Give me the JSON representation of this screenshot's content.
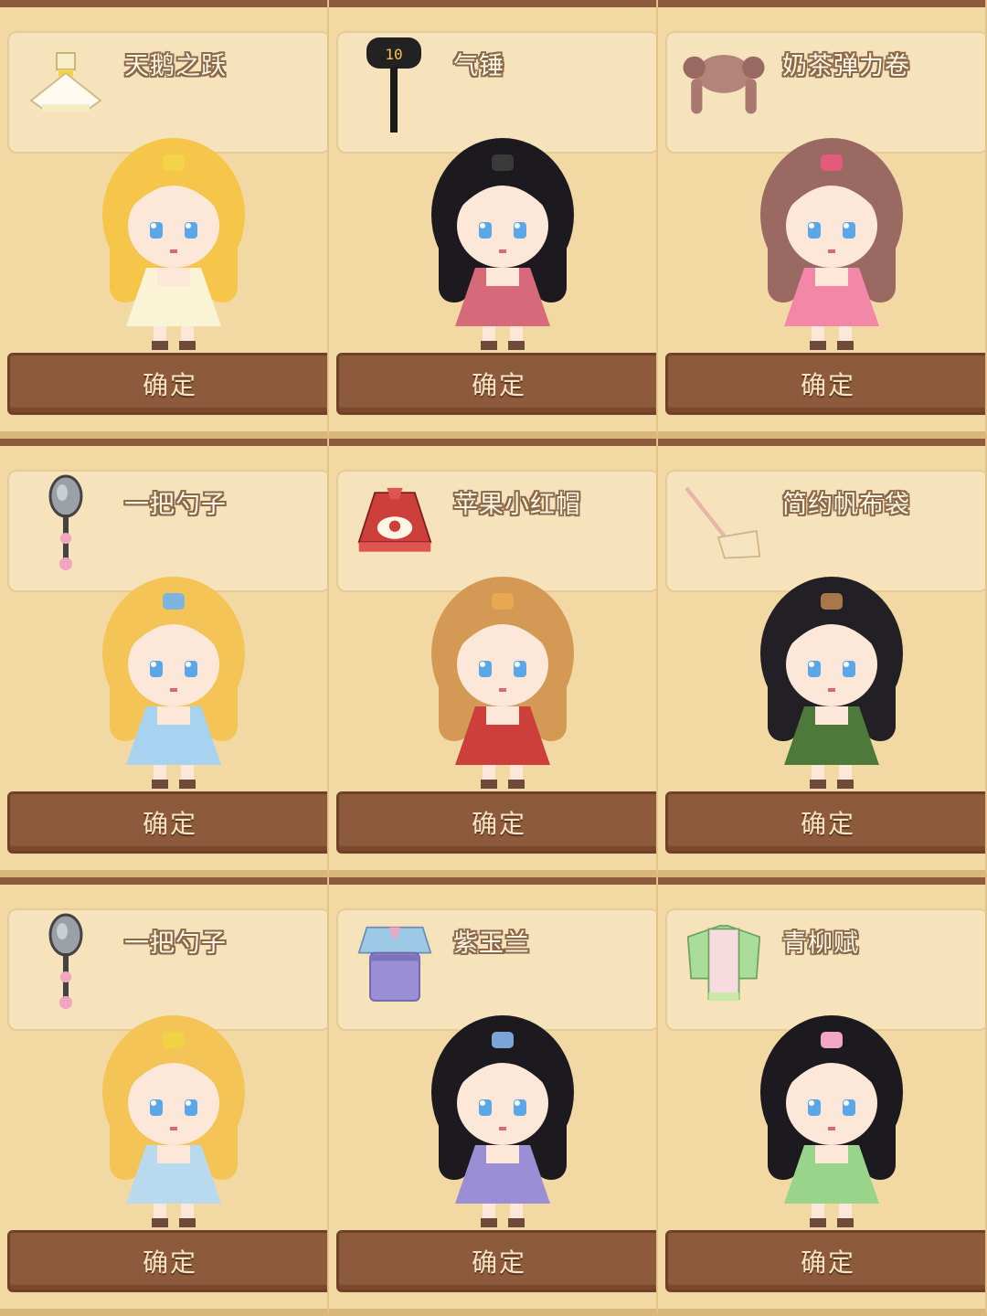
{
  "cards": [
    {
      "name": "天鹅之跃",
      "icon": "ballet-dress-icon",
      "hair": "#f6c64a",
      "outfit": "#fbf3d6",
      "accent": "#f3d34a",
      "button": "确定"
    },
    {
      "name": "气锤",
      "icon": "hammer-icon",
      "hammer_label": "10",
      "hair": "#1d1a1f",
      "outfit": "#d76a7a",
      "accent": "#3a3a3a",
      "button": "确定"
    },
    {
      "name": "奶茶弹力卷",
      "icon": "curly-hair-icon",
      "hair": "#9a6a62",
      "outfit": "#f287a7",
      "accent": "#e35b7b",
      "button": "确定"
    },
    {
      "name": "一把勺子",
      "icon": "spoon-icon",
      "hair": "#f4c457",
      "outfit": "#a8d3f0",
      "accent": "#7cb6e0",
      "button": "确定"
    },
    {
      "name": "苹果小红帽",
      "icon": "red-cape-dress-icon",
      "hair": "#d49a55",
      "outfit": "#cd3f3a",
      "accent": "#e8a850",
      "button": "确定"
    },
    {
      "name": "简约帆布袋",
      "icon": "canvas-bag-icon",
      "hair": "#222024",
      "outfit": "#4d7a3a",
      "accent": "#a9784a",
      "button": "确定"
    },
    {
      "name": "一把勺子",
      "icon": "spoon-icon",
      "hair": "#f4c457",
      "outfit": "#b9d9ef",
      "accent": "#f1d245",
      "button": "确定"
    },
    {
      "name": "紫玉兰",
      "icon": "hanfu-purple-icon",
      "hair": "#1c1a1f",
      "outfit": "#9a8fd4",
      "accent": "#7ba5d9",
      "button": "确定"
    },
    {
      "name": "青柳赋",
      "icon": "hanfu-green-icon",
      "hair": "#1c1a1f",
      "outfit": "#98d48a",
      "accent": "#f3a6c0",
      "button": "确定"
    }
  ]
}
